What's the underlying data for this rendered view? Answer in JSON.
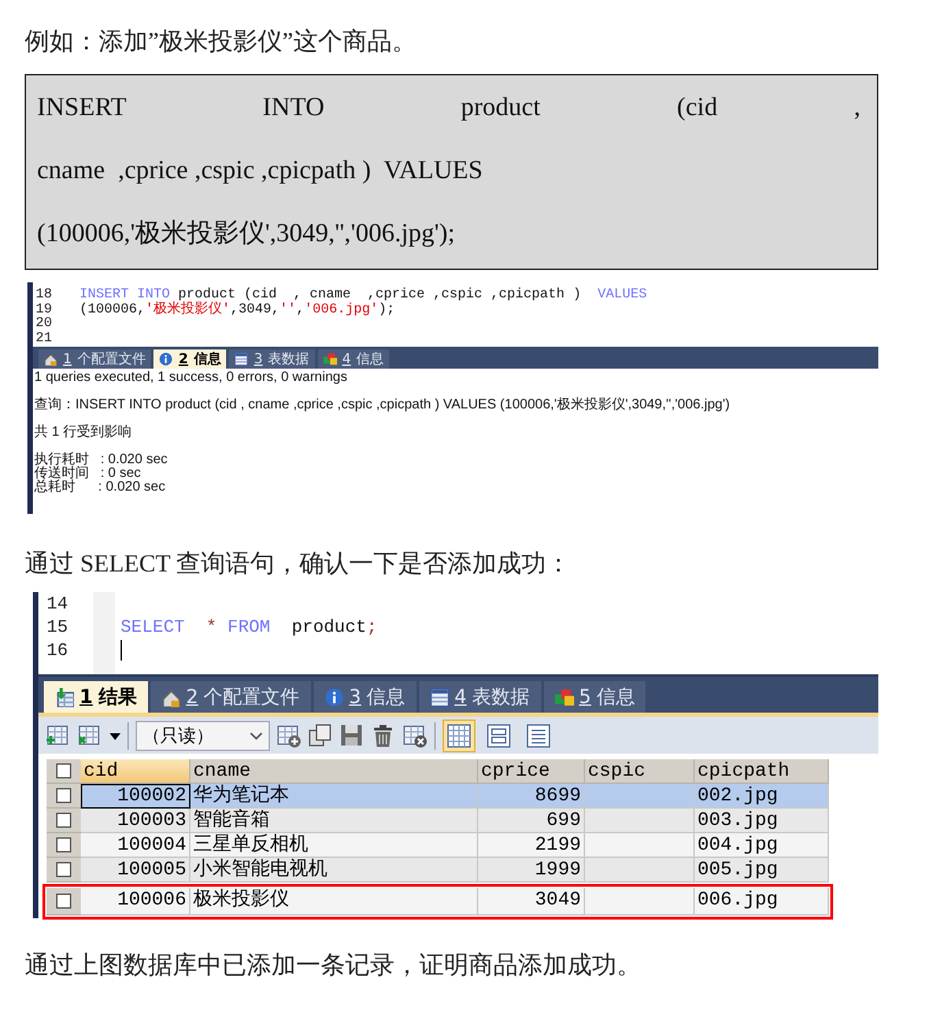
{
  "intro": "例如：添加”极米投影仪”这个商品。",
  "code_block": {
    "lines": [
      {
        "text": "INSERT INTO product (cid ,",
        "justified": true
      },
      {
        "text": "cname  ,cprice ,cspic ,cpicpath )  VALUES",
        "justified": false
      },
      {
        "text": "(100006,'极米投影仪',3049,'','006.jpg');",
        "justified": false
      }
    ]
  },
  "screenshot_1": {
    "editor": {
      "lines": [
        {
          "number": "18",
          "tokens": [
            {
              "kind": "keyword",
              "text": "INSERT INTO"
            },
            {
              "kind": "plain",
              "text": " product (cid  , cname  ,cprice ,cspic ,cpicpath )  "
            },
            {
              "kind": "keyword",
              "text": "VALUES"
            }
          ]
        },
        {
          "number": "19",
          "tokens": [
            {
              "kind": "plain",
              "text": "(100006,"
            },
            {
              "kind": "string",
              "text": "'极米投影仪'"
            },
            {
              "kind": "plain",
              "text": ",3049,"
            },
            {
              "kind": "string",
              "text": "''"
            },
            {
              "kind": "plain",
              "text": ","
            },
            {
              "kind": "string",
              "text": "'006.jpg'"
            },
            {
              "kind": "plain",
              "text": ");"
            }
          ]
        },
        {
          "number": "20"
        },
        {
          "number": "21"
        }
      ]
    },
    "tabs": [
      {
        "kind": "profile",
        "number": "1",
        "label": "个配置文件",
        "selected": false
      },
      {
        "kind": "info",
        "number": "2",
        "label": "信息",
        "selected": true
      },
      {
        "kind": "table",
        "number": "3",
        "label": "表数据",
        "selected": false
      },
      {
        "kind": "status",
        "number": "4",
        "label": "信息",
        "selected": false
      }
    ],
    "messages": [
      [
        "1 queries executed, 1 success, 0 errors, 0 warnings"
      ],
      [
        "查询：INSERT INTO product (cid , cname ,cprice ,cspic ,cpicpath ) VALUES (100006,'极米投影仪',3049,'','006.jpg')"
      ],
      [
        "共 1 行受到影响"
      ],
      [
        "执行耗时   : 0.020 sec",
        "传送时间   : 0 sec",
        "总耗时      : 0.020 sec"
      ]
    ]
  },
  "middle": "通过 SELECT 查询语句，确认一下是否添加成功：",
  "screenshot_2": {
    "editor": {
      "lines": [
        {
          "number": "14"
        },
        {
          "number": "15",
          "tokens": [
            {
              "kind": "keyword",
              "text": "SELECT"
            },
            {
              "kind": "operator",
              "text": "  *"
            },
            {
              "kind": "keyword",
              "text": " FROM"
            },
            {
              "kind": "plain",
              "text": "  product"
            },
            {
              "kind": "operator",
              "text": ";"
            }
          ]
        },
        {
          "number": "16",
          "cursor": true
        }
      ]
    },
    "tabs": [
      {
        "kind": "result",
        "number": "1",
        "label": "结果",
        "selected": true
      },
      {
        "kind": "profile",
        "number": "2",
        "label": "个配置文件",
        "selected": false
      },
      {
        "kind": "info",
        "number": "3",
        "label": "信息",
        "selected": false
      },
      {
        "kind": "table",
        "number": "4",
        "label": "表数据",
        "selected": false
      },
      {
        "kind": "status",
        "number": "5",
        "label": "信息",
        "selected": false
      }
    ],
    "toolbar": {
      "select": "（只读）",
      "view_modes": [
        {
          "selected": true
        },
        {
          "selected": false
        },
        {
          "selected": false
        }
      ]
    },
    "grid": {
      "select_all_checked": false,
      "columns": [
        {
          "label": "cid",
          "kind": "number",
          "selected": true
        },
        {
          "label": "cname",
          "kind": "text",
          "selected": false
        },
        {
          "label": "cprice",
          "kind": "number",
          "selected": false
        },
        {
          "label": "cspic",
          "kind": "text",
          "selected": false
        },
        {
          "label": "cpicpath",
          "kind": "text",
          "selected": false
        }
      ],
      "rows": [
        {
          "checked": false,
          "selected": true,
          "highlighted": false,
          "cells": [
            "100002",
            "华为笔记本",
            "8699",
            null,
            "002.jpg"
          ]
        },
        {
          "checked": false,
          "selected": false,
          "highlighted": false,
          "cells": [
            "100003",
            "智能音箱",
            "699",
            null,
            "003.jpg"
          ]
        },
        {
          "checked": false,
          "selected": false,
          "highlighted": false,
          "cells": [
            "100004",
            "三星单反相机",
            "2199",
            null,
            "004.jpg"
          ]
        },
        {
          "checked": false,
          "selected": false,
          "highlighted": false,
          "cells": [
            "100005",
            "小米智能电视机",
            "1999",
            null,
            "005.jpg"
          ]
        },
        {
          "checked": false,
          "selected": false,
          "highlighted": true,
          "cells": [
            "100006",
            "极米投影仪",
            "3049",
            null,
            "006.jpg"
          ]
        }
      ]
    }
  },
  "outro": "通过上图数据库中已添加一条记录，证明商品添加成功。"
}
